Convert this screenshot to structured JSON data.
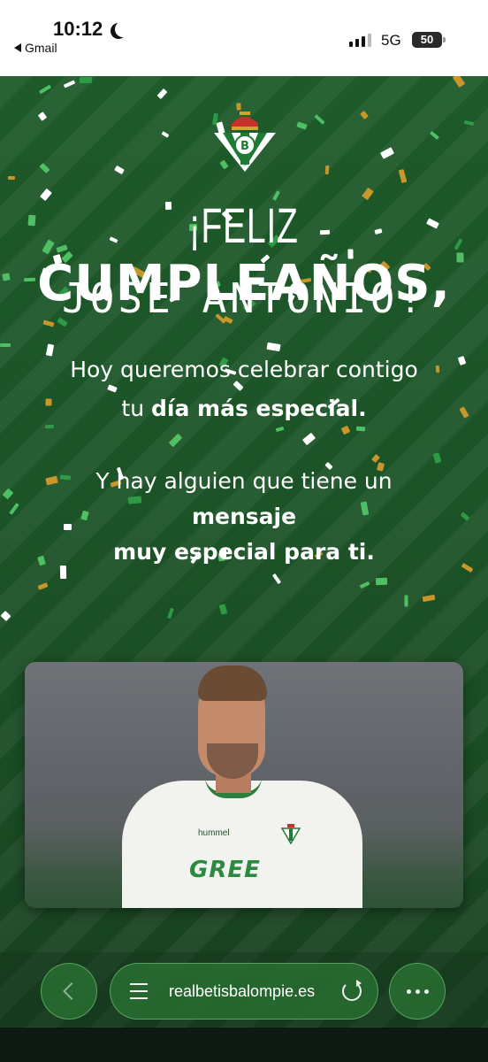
{
  "status_bar": {
    "time": "10:12",
    "back_app": "Gmail",
    "network": "5G",
    "battery": "50"
  },
  "hero": {
    "title_light": "¡FELIZ",
    "title_bold": "CUMPLEAÑOS,",
    "name": "JOSE ANTONIO!",
    "line1": "Hoy queremos celebrar contigo",
    "line2_pre": "tu",
    "line2_bold": "día más especial.",
    "line3": "Y hay alguien que tiene un",
    "line4_bold": "mensaje",
    "line5_bold": "muy especial para ti."
  },
  "video": {
    "sponsor": "GREE",
    "brand": "hummel"
  },
  "browser": {
    "url": "realbetisbalompie.es"
  },
  "colors": {
    "background_green": "#1c5327",
    "accent_green": "#2b8a3e",
    "confetti_gold": "#c9962c"
  }
}
